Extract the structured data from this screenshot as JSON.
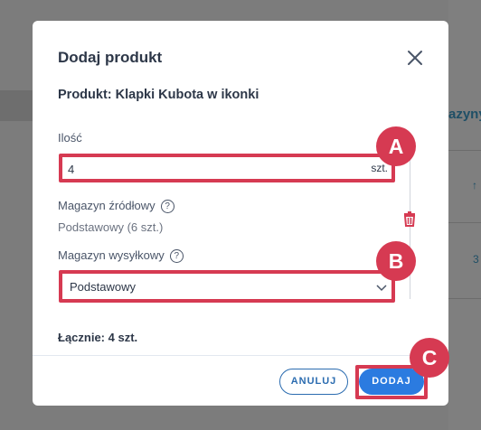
{
  "background": {
    "right_heading": "azyny",
    "right_sort_glyph": "↑",
    "right_number": "3"
  },
  "modal": {
    "title": "Dodaj produkt",
    "product_line": "Produkt: Klapki Kubota w ikonki",
    "quantity": {
      "label": "Ilość",
      "value": "4",
      "unit": "szt."
    },
    "source_warehouse": {
      "label": "Magazyn źródłowy",
      "value": "Podstawowy (6 szt.)"
    },
    "shipping_warehouse": {
      "label": "Magazyn wysyłkowy",
      "selected": "Podstawowy"
    },
    "total": "Łącznie: 4 szt.",
    "buttons": {
      "cancel": "ANULUJ",
      "add": "DODAJ"
    }
  },
  "markers": {
    "a": "A",
    "b": "B",
    "c": "C"
  },
  "colors": {
    "highlight": "#d63a52",
    "primary": "#2b7be0",
    "primary_outline": "#2b6cb0",
    "trash": "#d63a52"
  },
  "icons": {
    "close": "close-icon",
    "help": "help-icon",
    "trash": "trash-icon",
    "chevron": "chevron-down-icon"
  }
}
